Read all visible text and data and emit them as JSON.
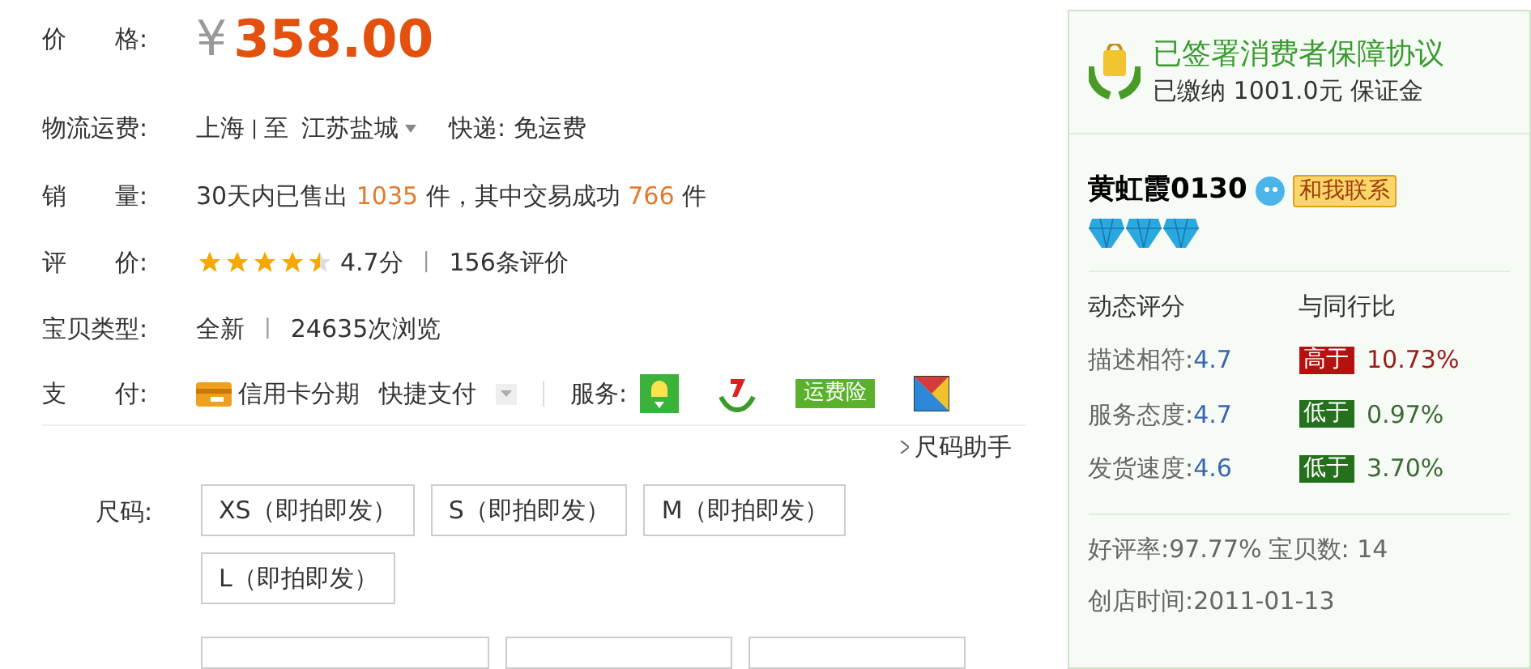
{
  "price": {
    "label": "价　　格:",
    "currency": "¥",
    "amount": "358.00"
  },
  "shipping": {
    "label": "物流运费:",
    "from": "上海",
    "separator": "|",
    "to_word": "至",
    "to": "江苏盐城",
    "express": "快递: 免运费"
  },
  "sales": {
    "label": "销　　量:",
    "prefix": "30天内已售出",
    "sold": "1035",
    "middle": "件，其中交易成功",
    "success": "766",
    "suffix": "件"
  },
  "rating": {
    "label": "评　　价:",
    "stars": 4.5,
    "score": "4.7分",
    "separator": "|",
    "reviews": "156条评价"
  },
  "item_type": {
    "label": "宝贝类型:",
    "condition": "全新",
    "separator": "|",
    "views": "24635次浏览"
  },
  "payment": {
    "label": "支　　付:",
    "methods": [
      "信用卡分期",
      "快捷支付"
    ],
    "services_label": "服务:",
    "insurance": "运费险"
  },
  "size_helper": "尺码助手",
  "sizes": {
    "label": "尺码:",
    "options": [
      {
        "label": "XS（即拍即发）",
        "selected": false
      },
      {
        "label": "S（即拍即发）",
        "selected": false
      },
      {
        "label": "M（即拍即发）",
        "selected": false
      },
      {
        "label": "L（即拍即发）",
        "selected": false
      }
    ]
  },
  "seller": {
    "guarantee_title": "已签署消费者保障协议",
    "guarantee_deposit": "已缴纳 1001.0元 保证金",
    "name": "黄虹霞0130",
    "contact": "和我联系",
    "badges": [
      {
        "kind": "diamond"
      },
      {
        "kind": "diamond"
      },
      {
        "kind": "diamond"
      }
    ],
    "score_header": "动态评分",
    "compare_header": "与同行比",
    "scores": [
      {
        "label": "描述相符:",
        "value": "4.7",
        "kind": "above",
        "badge": "高于",
        "percent": "10.73%"
      },
      {
        "label": "服务态度:",
        "value": "4.7",
        "kind": "below",
        "badge": "低于",
        "percent": "0.97%"
      },
      {
        "label": "发货速度:",
        "value": "4.6",
        "kind": "below",
        "badge": "低于",
        "percent": "3.70%"
      }
    ],
    "positive_rate": "好评率:97.77%",
    "item_count": "宝贝数: 14",
    "opened": "创店时间:2011-01-13"
  }
}
